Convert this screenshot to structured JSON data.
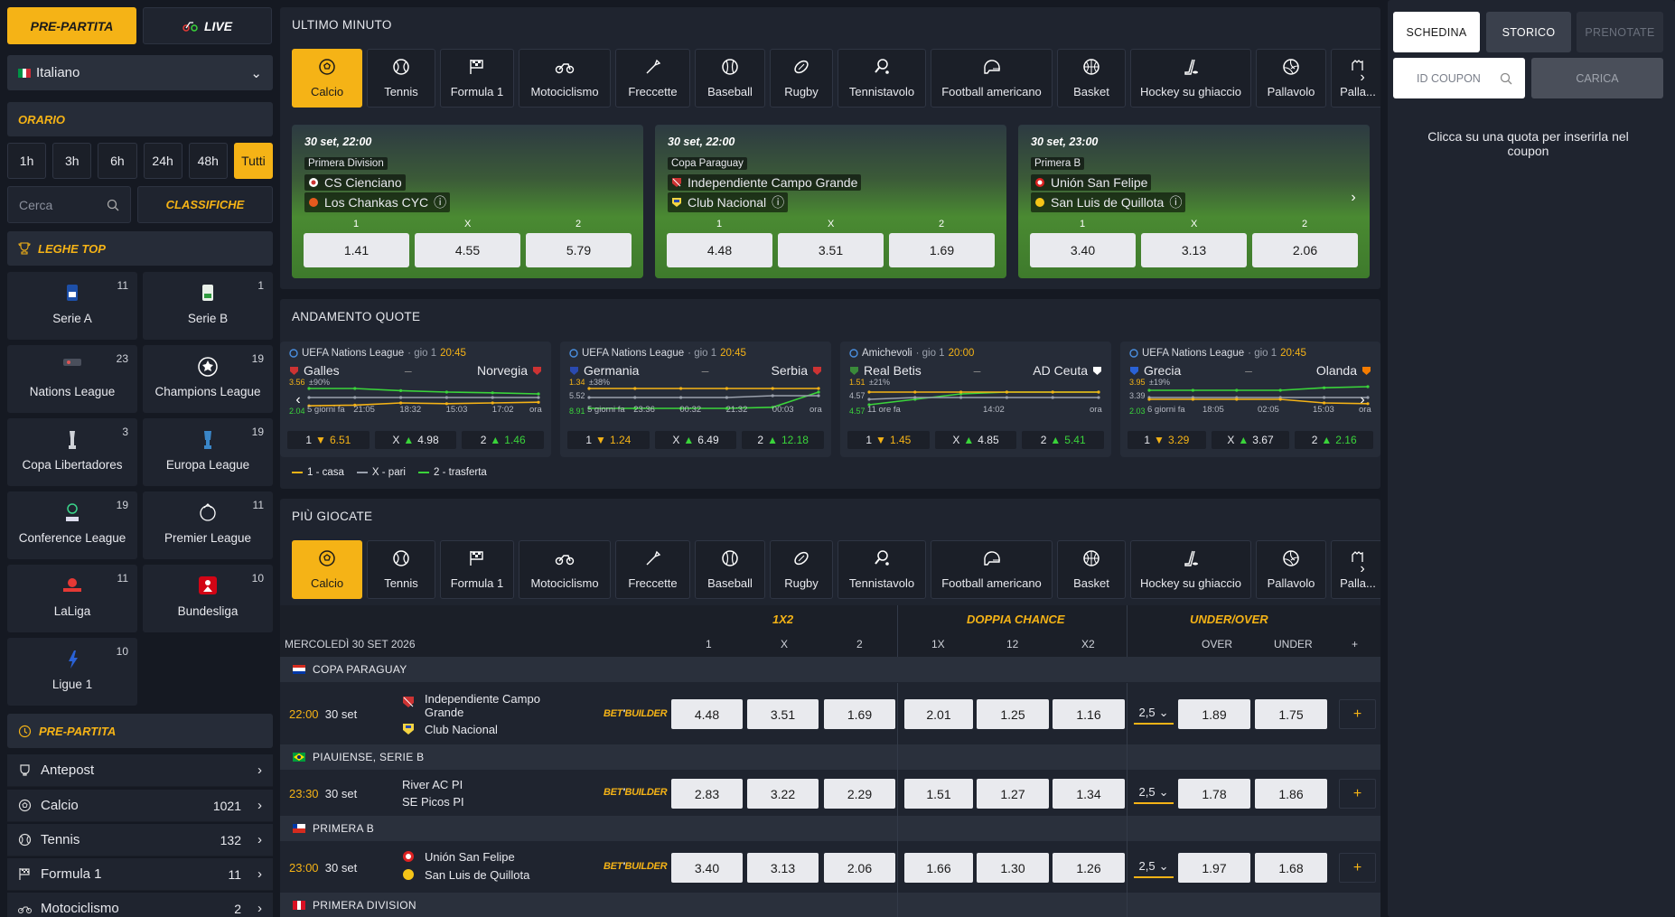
{
  "top": {
    "prepartita": "PRE-PARTITA",
    "live": "LIVE"
  },
  "language": {
    "selected": "Italiano"
  },
  "orario": {
    "title": "ORARIO",
    "options": [
      "1h",
      "3h",
      "6h",
      "24h",
      "48h",
      "Tutti"
    ],
    "active": "Tutti"
  },
  "search": {
    "placeholder": "Cerca"
  },
  "classifiche": "CLASSIFICHE",
  "leghe_top": {
    "title": "LEGHE TOP",
    "items": [
      {
        "name": "Serie A",
        "count": "11"
      },
      {
        "name": "Serie B",
        "count": "1"
      },
      {
        "name": "Nations League",
        "count": "23"
      },
      {
        "name": "Champions League",
        "count": "19"
      },
      {
        "name": "Copa Libertadores",
        "count": "3"
      },
      {
        "name": "Europa League",
        "count": "19"
      },
      {
        "name": "Conference League",
        "count": "19"
      },
      {
        "name": "Premier League",
        "count": "11"
      },
      {
        "name": "LaLiga",
        "count": "11"
      },
      {
        "name": "Bundesliga",
        "count": "10"
      },
      {
        "name": "Ligue 1",
        "count": "10"
      }
    ]
  },
  "prepartita_menu": {
    "title": "PRE-PARTITA",
    "items": [
      {
        "name": "Antepost",
        "count": ""
      },
      {
        "name": "Calcio",
        "count": "1021"
      },
      {
        "name": "Tennis",
        "count": "132"
      },
      {
        "name": "Formula 1",
        "count": "11"
      },
      {
        "name": "Motociclismo",
        "count": "2"
      }
    ]
  },
  "sports": [
    "Calcio",
    "Tennis",
    "Formula 1",
    "Motociclismo",
    "Freccette",
    "Baseball",
    "Rugby",
    "Tennistavolo",
    "Football americano",
    "Basket",
    "Hockey su ghiaccio",
    "Pallavolo",
    "Palla..."
  ],
  "ultimo_minuto": {
    "title": "ULTIMO MINUTO",
    "cards": [
      {
        "date": "30 set, 22:00",
        "competition": "Primera Division",
        "home": "CS Cienciano",
        "away": "Los Chankas CYC",
        "labels": [
          "1",
          "X",
          "2"
        ],
        "odds": [
          "1.41",
          "4.55",
          "5.79"
        ]
      },
      {
        "date": "30 set, 22:00",
        "competition": "Copa Paraguay",
        "home": "Independiente Campo Grande",
        "away": "Club Nacional",
        "labels": [
          "1",
          "X",
          "2"
        ],
        "odds": [
          "4.48",
          "3.51",
          "1.69"
        ]
      },
      {
        "date": "30 set, 23:00",
        "competition": "Primera B",
        "home": "Unión San Felipe",
        "away": "San Luis de Quillota",
        "labels": [
          "1",
          "X",
          "2"
        ],
        "odds": [
          "3.40",
          "3.13",
          "2.06"
        ]
      }
    ]
  },
  "andamento": {
    "title": "ANDAMENTO QUOTE",
    "cards": [
      {
        "league": "UEFA Nations League",
        "day": "gio 1",
        "time": "20:45",
        "home": "Galles",
        "away": "Norvegia",
        "pct": "±90%",
        "y_high": "3.56",
        "y_low": "2.04",
        "x": [
          "5 giorni fa",
          "21:05",
          "18:32",
          "15:03",
          "17:02",
          "ora"
        ],
        "o1": "6.51",
        "ox": "4.98",
        "o2": "1.46",
        "d1": "down",
        "dx": "up",
        "d2": "up"
      },
      {
        "league": "UEFA Nations League",
        "day": "gio 1",
        "time": "20:45",
        "home": "Germania",
        "away": "Serbia",
        "pct": "±38%",
        "y_high": "1.34",
        "y_mid": "5.52",
        "y_low": "8.91",
        "x": [
          "5 giorni fa",
          "23:36",
          "00:32",
          "21:32",
          "00:03",
          "ora"
        ],
        "o1": "1.24",
        "ox": "6.49",
        "o2": "12.18",
        "d1": "down",
        "dx": "up",
        "d2": "up"
      },
      {
        "league": "Amichevoli",
        "day": "gio 1",
        "time": "20:00",
        "home": "Real Betis",
        "away": "AD Ceuta",
        "pct": "±21%",
        "y_high": "1.51",
        "y_mid": "4.57",
        "y_low": "4.57",
        "x": [
          "11 ore fa",
          "14:02",
          "ora"
        ],
        "o1": "1.45",
        "ox": "4.85",
        "o2": "5.41",
        "d1": "down",
        "dx": "up",
        "d2": "up"
      },
      {
        "league": "UEFA Nations League",
        "day": "gio 1",
        "time": "20:45",
        "home": "Grecia",
        "away": "Olanda",
        "pct": "±19%",
        "y_high": "3.95",
        "y_mid": "3.39",
        "y_low": "2.03",
        "x": [
          "6 giorni fa",
          "18:05",
          "02:05",
          "15:03",
          "ora"
        ],
        "o1": "3.29",
        "ox": "3.67",
        "o2": "2.16",
        "d1": "down",
        "dx": "up",
        "d2": "up"
      }
    ],
    "legend": [
      "1 - casa",
      "X - pari",
      "2 - trasferta"
    ]
  },
  "piu_giocate": {
    "title": "PIÙ GIOCATE",
    "date_label": "MERCOLEDÌ 30 SET 2026",
    "groups": {
      "g1": "1X2",
      "g2": "DOPPIA CHANCE",
      "g3": "UNDER/OVER"
    },
    "cols": {
      "c1": "1",
      "cx": "X",
      "c2": "2",
      "d1": "1X",
      "d2": "12",
      "d3": "X2",
      "over": "OVER",
      "under": "UNDER",
      "plus": "+"
    },
    "bet_builder": {
      "a": "BET",
      "b": "BUILDER"
    },
    "competitions": [
      "COPA PARAGUAY",
      "PIAUIENSE, SERIE B",
      "PRIMERA B",
      "PRIMERA DIVISION"
    ],
    "rows": [
      {
        "time": "22:00",
        "date": "30 set",
        "home": "Independiente Campo Grande",
        "away": "Club Nacional",
        "o1": "4.48",
        "ox": "3.51",
        "o2": "1.69",
        "dc1": "2.01",
        "dc2": "1.25",
        "dc3": "1.16",
        "line": "2,5",
        "over": "1.89",
        "under": "1.75"
      },
      {
        "time": "23:30",
        "date": "30 set",
        "home": "River AC PI",
        "away": "SE Picos PI",
        "o1": "2.83",
        "ox": "3.22",
        "o2": "2.29",
        "dc1": "1.51",
        "dc2": "1.27",
        "dc3": "1.34",
        "line": "2,5",
        "over": "1.78",
        "under": "1.86"
      },
      {
        "time": "23:00",
        "date": "30 set",
        "home": "Unión San Felipe",
        "away": "San Luis de Quillota",
        "o1": "3.40",
        "ox": "3.13",
        "o2": "2.06",
        "dc1": "1.66",
        "dc2": "1.30",
        "dc3": "1.26",
        "line": "2,5",
        "over": "1.97",
        "under": "1.68"
      }
    ]
  },
  "schedina": {
    "tabs": [
      "SCHEDINA",
      "STORICO",
      "PRENOTATE"
    ],
    "coupon_placeholder": "ID COUPON",
    "carica": "CARICA",
    "empty_msg": "Clicca su una quota per inserirla nel coupon"
  },
  "colors": {
    "accent": "#f5b316",
    "bg": "#151922",
    "panel": "#1f242f",
    "up": "#3ad43a",
    "down": "#f5b316"
  }
}
